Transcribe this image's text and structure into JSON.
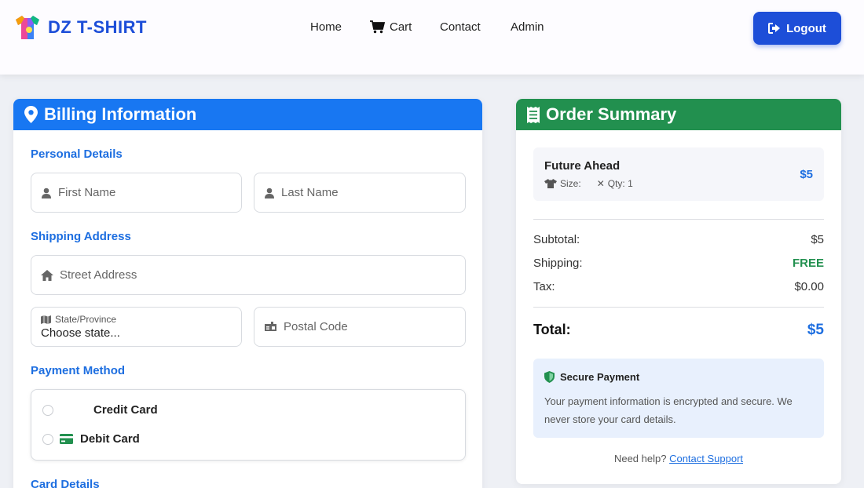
{
  "brand": {
    "name": "DZ T-SHIRT"
  },
  "nav": {
    "home": "Home",
    "cart": "Cart",
    "contact": "Contact",
    "admin": "Admin",
    "logout": "Logout"
  },
  "billing": {
    "title": "Billing Information",
    "personal_title": "Personal Details",
    "first_name_placeholder": "First Name",
    "last_name_placeholder": "Last Name",
    "shipping_title": "Shipping Address",
    "street_placeholder": "Street Address",
    "state_label": "State/Province",
    "state_value": "Choose state...",
    "postal_placeholder": "Postal Code",
    "payment_title": "Payment Method",
    "credit_card": "Credit Card",
    "debit_card": "Debit Card",
    "card_details_title": "Card Details"
  },
  "summary": {
    "title": "Order Summary",
    "item": {
      "name": "Future Ahead",
      "size_label": "Size:",
      "qty_label": "Qty: 1",
      "price": "$5"
    },
    "subtotal_label": "Subtotal:",
    "subtotal_value": "$5",
    "shipping_label": "Shipping:",
    "shipping_value": "FREE",
    "tax_label": "Tax:",
    "tax_value": "$0.00",
    "total_label": "Total:",
    "total_value": "$5",
    "secure_title": "Secure Payment",
    "secure_text": "Your payment information is encrypted and secure. We never store your card details.",
    "help_text": "Need help?",
    "help_link": "Contact Support"
  },
  "colors": {
    "primary": "#1d4ed8",
    "billing_header": "#1877f2",
    "summary_header": "#22904f",
    "free": "#22904f"
  }
}
